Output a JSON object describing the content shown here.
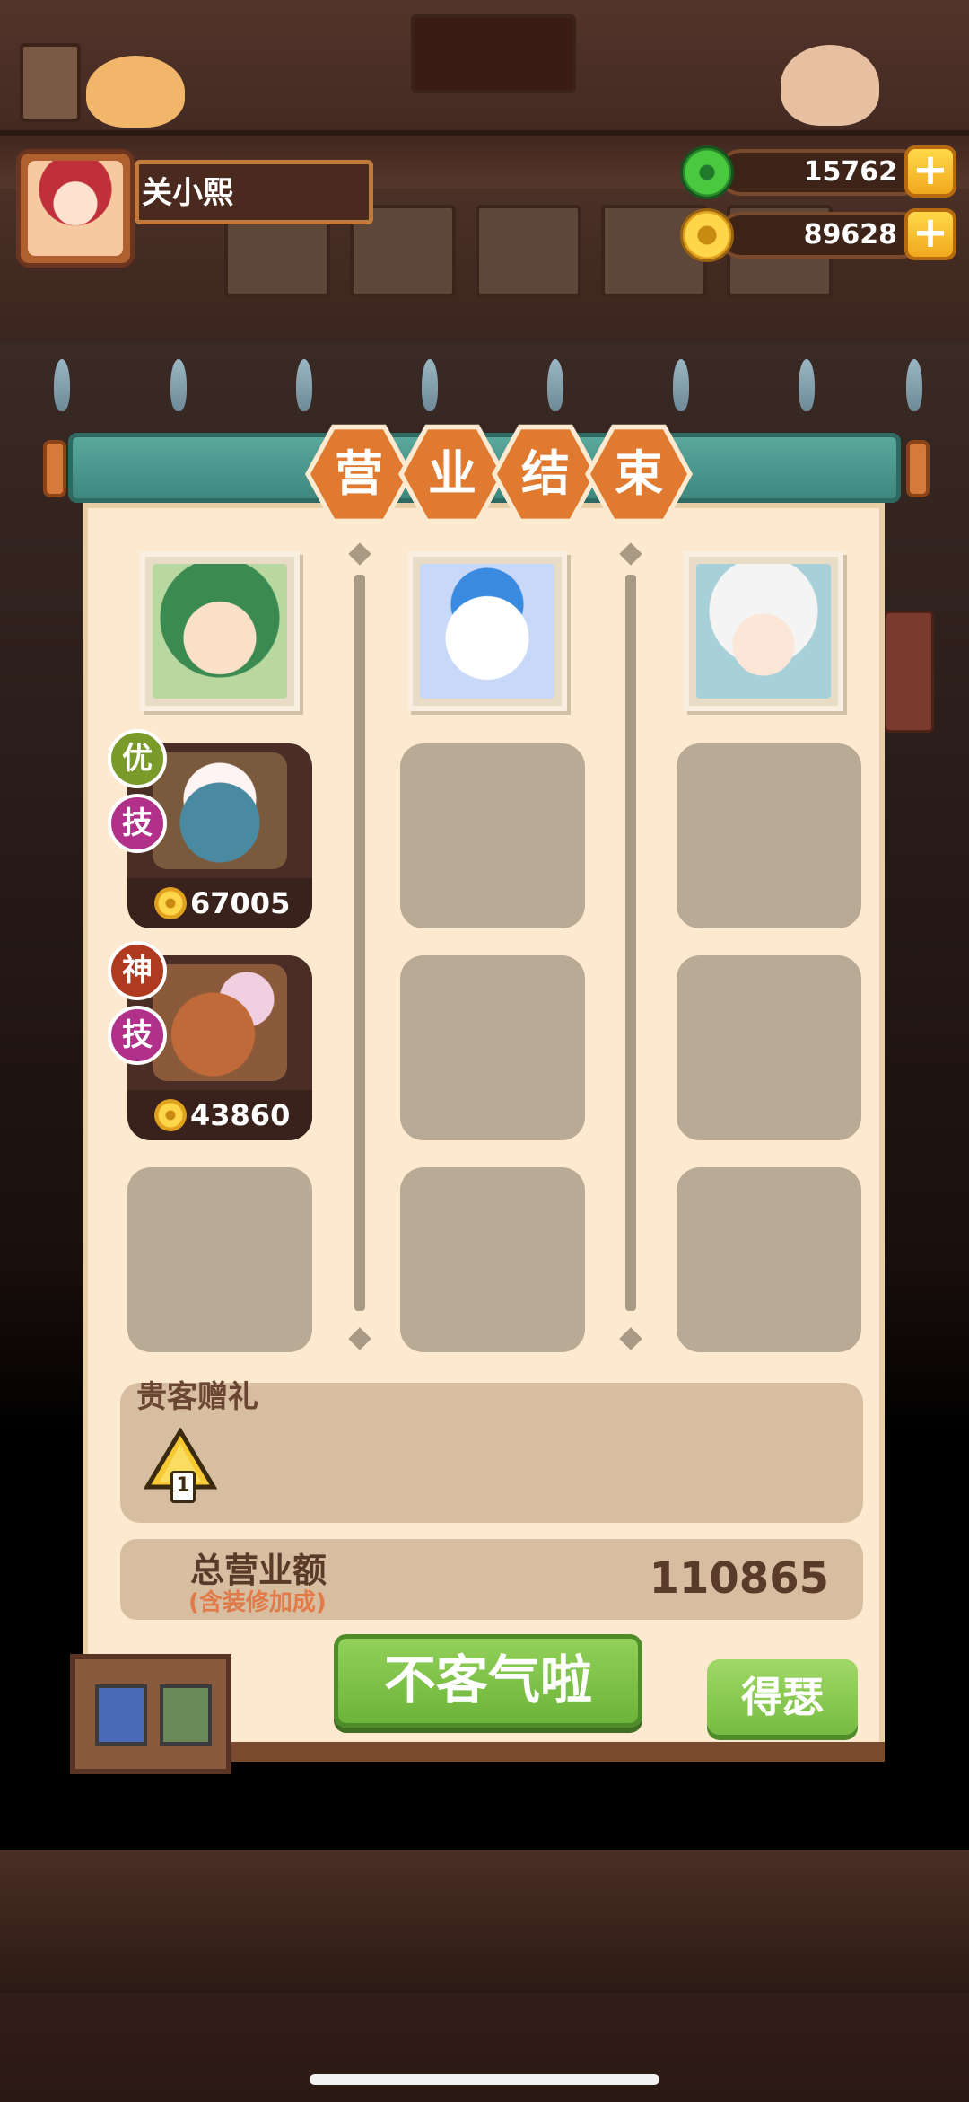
{
  "player": {
    "name": "关小熙"
  },
  "currency": {
    "jade": "15762",
    "coins": "89628",
    "plus_symbol": "+"
  },
  "title_chars": [
    "营",
    "业",
    "结",
    "束"
  ],
  "chefs": [
    {
      "dishes": [
        {
          "earnings": "67005",
          "badges": [
            "优",
            "技"
          ]
        },
        {
          "earnings": "43860",
          "badges": [
            "神",
            "技"
          ]
        }
      ]
    },
    {
      "dishes": []
    },
    {
      "dishes": []
    }
  ],
  "gift": {
    "label": "贵客赠礼",
    "item_count": "1"
  },
  "total": {
    "label": "总营业额",
    "note": "(含装修加成)",
    "value": "110865"
  },
  "buttons": {
    "main": "不客气啦",
    "secondary": "得瑟"
  },
  "colors": {
    "accent_orange": "#e07a30",
    "panel_bg": "#fde9cf",
    "button_green": "#6cb43a",
    "badge_green": "#7a9a2a",
    "badge_purple": "#b0308a",
    "badge_red": "#b03a20"
  }
}
